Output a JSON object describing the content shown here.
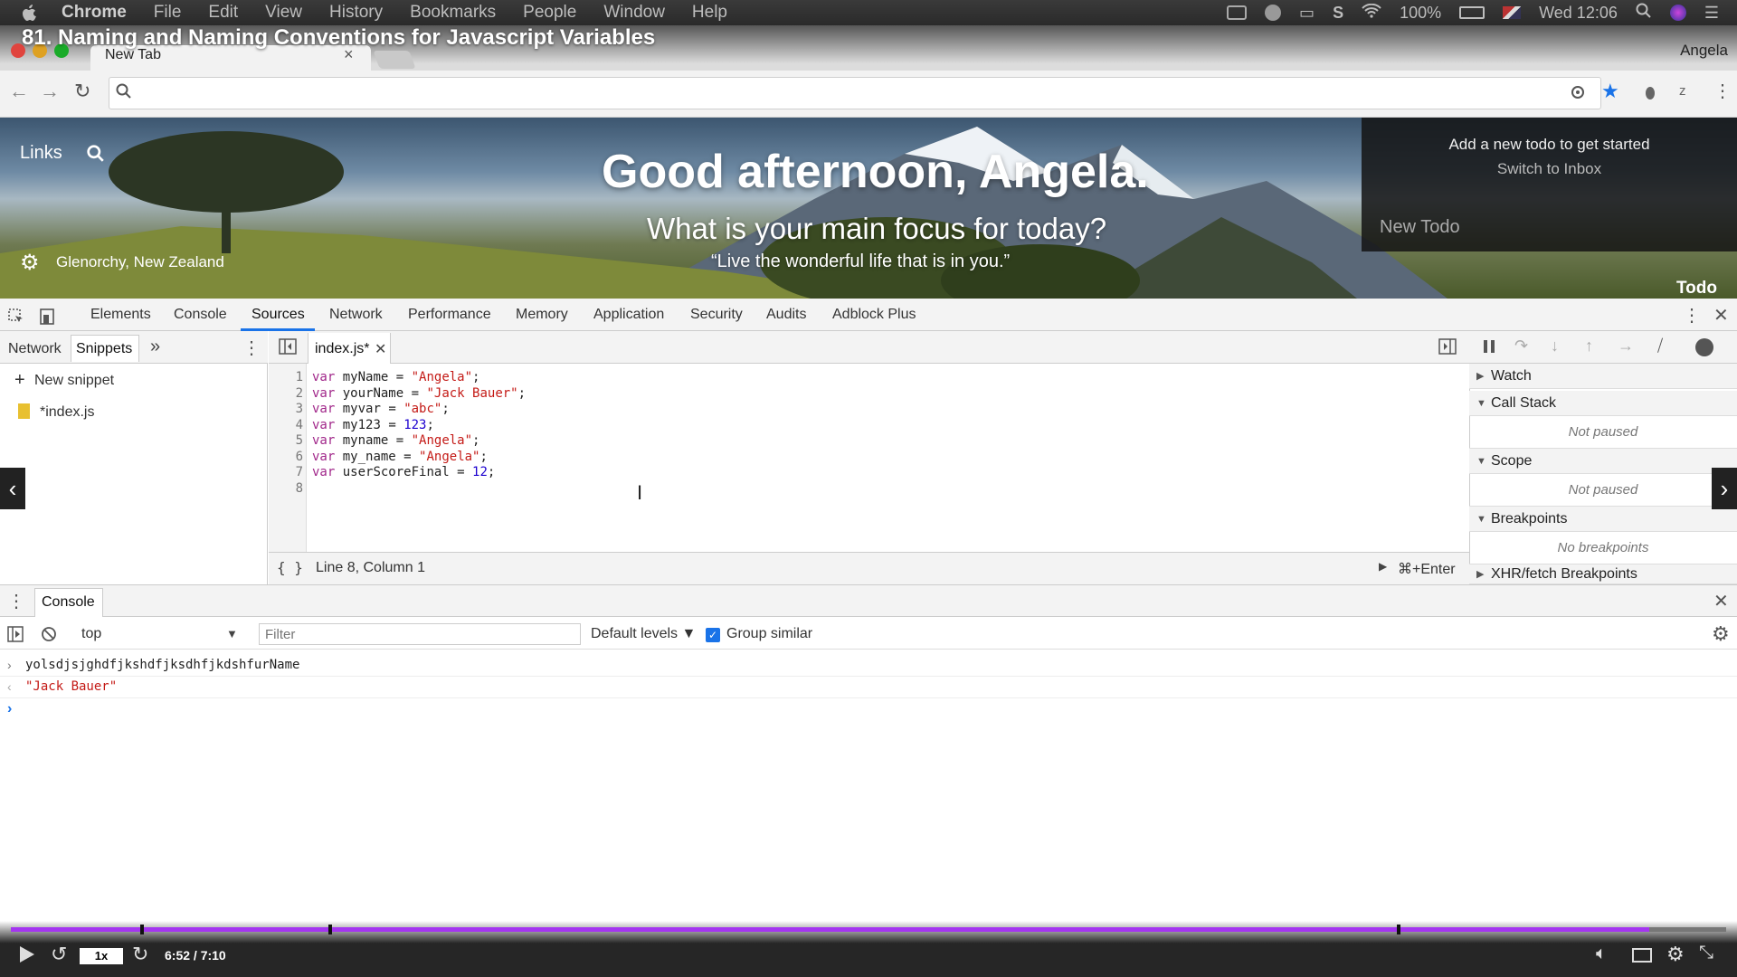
{
  "menubar": {
    "app": "Chrome",
    "items": [
      "File",
      "Edit",
      "View",
      "History",
      "Bookmarks",
      "People",
      "Window",
      "Help"
    ],
    "battery": "100%",
    "clock": "Wed 12:06"
  },
  "video": {
    "title": "81. Naming and Naming Conventions for Javascript Variables",
    "speed": "1x",
    "time": "6:52 / 7:10",
    "progress_fraction": 0.955
  },
  "browser": {
    "tab_title": "New Tab",
    "tab_close": "×",
    "profile": "Angela",
    "omnibox_value": ""
  },
  "momentum": {
    "links": "Links",
    "greeting": "Good afternoon, Angela.",
    "focus": "What is your main focus for today?",
    "quote": "“Live the wonderful life that is in you.”",
    "location": "Glenorchy, New Zealand",
    "todo_add": "Add a new todo to get started",
    "todo_switch": "Switch to Inbox",
    "todo_new": "New Todo",
    "todo_label": "Todo"
  },
  "devtools": {
    "tabs": [
      "Elements",
      "Console",
      "Sources",
      "Network",
      "Performance",
      "Memory",
      "Application",
      "Security",
      "Audits",
      "Adblock Plus"
    ],
    "left_tabs": [
      "Network",
      "Snippets"
    ],
    "more": "»",
    "new_snippet": "New snippet",
    "snippet_file": "*index.js",
    "editor_tab": "index.js*",
    "code": [
      {
        "ln": "1",
        "name": "myName",
        "value": "\"Angela\""
      },
      {
        "ln": "2",
        "name": "yourName",
        "value": "\"Jack Bauer\""
      },
      {
        "ln": "3",
        "name": "myvar",
        "value": "\"abc\""
      },
      {
        "ln": "4",
        "name": "my123",
        "value": "123"
      },
      {
        "ln": "5",
        "name": "myname",
        "value": "\"Angela\""
      },
      {
        "ln": "6",
        "name": "my_name",
        "value": "\"Angela\""
      },
      {
        "ln": "7",
        "name": "userScoreFinal",
        "value": "12"
      },
      {
        "ln": "8",
        "name": "",
        "value": ""
      }
    ],
    "kw": "var",
    "eq": " = ",
    "semi": ";",
    "pretty": "{ }",
    "cursor_pos": "Line 8, Column 1",
    "run": "⌘+Enter",
    "debugger": {
      "watch": "Watch",
      "call_stack": "Call Stack",
      "not_paused": "Not paused",
      "scope": "Scope",
      "breakpoints": "Breakpoints",
      "no_breakpoints": "No breakpoints",
      "xhr": "XHR/fetch Breakpoints"
    }
  },
  "console": {
    "tab": "Console",
    "context": "top",
    "filter_placeholder": "Filter",
    "levels": "Default levels ▼",
    "group_similar": "Group similar",
    "input": "yolsdjsjghdfjkshdfjksdhfjkdshfurName",
    "output": "\"Jack Bauer\""
  }
}
